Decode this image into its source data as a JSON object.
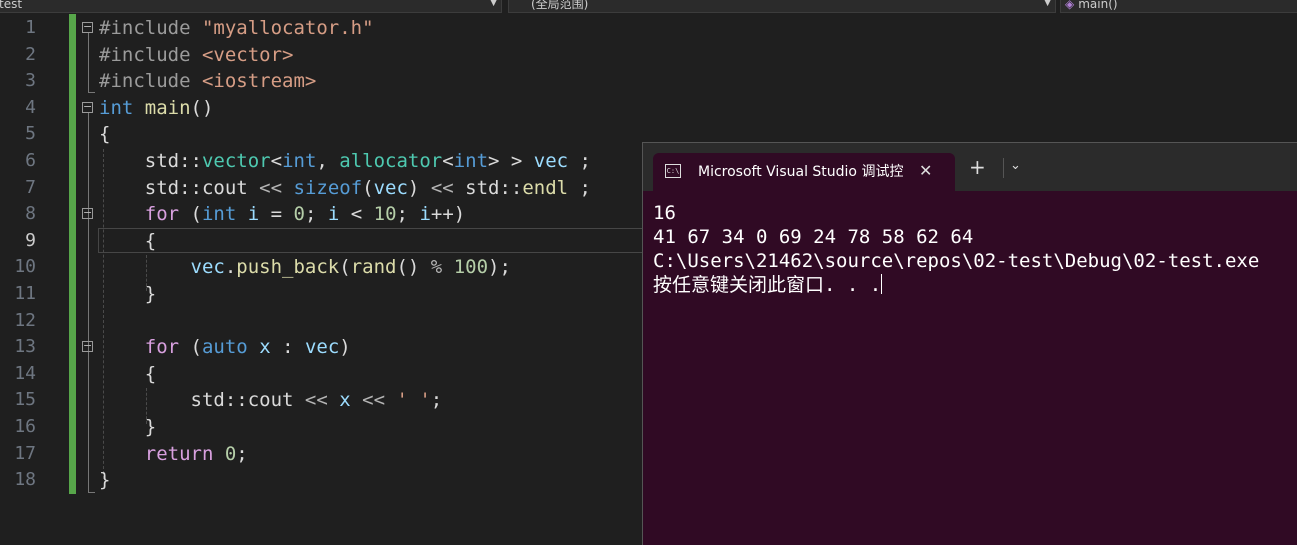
{
  "navbar": {
    "project": "test",
    "scope": "(全局范围)",
    "member": "main()"
  },
  "editor": {
    "line_numbers": [
      "1",
      "2",
      "3",
      "4",
      "5",
      "6",
      "7",
      "8",
      "9",
      "10",
      "11",
      "12",
      "13",
      "14",
      "15",
      "16",
      "17",
      "18"
    ],
    "current_line": "9",
    "code": {
      "include1_kw": "#include",
      "include1_arg": "\"myallocator.h\"",
      "include2_kw": "#include",
      "include2_arg": "<vector>",
      "include3_kw": "#include",
      "include3_arg": "<iostream>",
      "main_type": "int",
      "main_name": "main",
      "main_parens": "()",
      "open_brace": "{",
      "vec_std": "std::",
      "vec_type": "vector",
      "vec_lt": "<",
      "vec_int": "int",
      "vec_comma": ", ",
      "vec_alloc": "allocator",
      "vec_lt2": "<",
      "vec_int2": "int",
      "vec_gt": "> > ",
      "vec_name": "vec",
      "vec_semi": " ;",
      "cout_std": "std::",
      "cout_name": "cout",
      "cout_op": " << ",
      "sizeof_kw": "sizeof",
      "sizeof_open": "(",
      "sizeof_arg": "vec",
      "sizeof_close": ")",
      "cout_op2": " << ",
      "endl_std": "std::",
      "endl_name": "endl",
      "cout_semi": " ;",
      "for1_kw": "for",
      "for1_open": " (",
      "for1_int": "int",
      "for1_i": " i",
      "for1_eq": " = ",
      "for1_zero": "0",
      "for1_semi": "; ",
      "for1_i2": "i",
      "for1_lt": " < ",
      "for1_ten": "10",
      "for1_semi2": "; ",
      "for1_i3": "i",
      "for1_inc": "++)",
      "for1_lbrace": "{",
      "push_vec": "vec",
      "push_dot": ".",
      "push_name": "push_back",
      "push_open": "(",
      "push_rand": "rand",
      "push_rand_parens": "()",
      "push_mod": " % ",
      "push_100": "100",
      "push_close": ");",
      "for1_rbrace": "}",
      "for2_kw": "for",
      "for2_open": " (",
      "for2_auto": "auto",
      "for2_x": " x",
      "for2_colon": " : ",
      "for2_vec": "vec",
      "for2_close": ")",
      "for2_lbrace": "{",
      "print_std": "std::",
      "print_cout": "cout",
      "print_op": " << ",
      "print_x": "x",
      "print_op2": " << ",
      "print_char": "' '",
      "print_semi": ";",
      "for2_rbrace": "}",
      "return_kw": "return",
      "return_zero": " 0",
      "return_semi": ";",
      "close_brace": "}"
    }
  },
  "terminal": {
    "tab_title": "Microsoft Visual Studio 调试控制台",
    "tab_icon": "C:\\",
    "close_glyph": "✕",
    "new_tab_glyph": "+",
    "dropdown_glyph": "⌄",
    "output": [
      "16",
      "41 67 34 0 69 24 78 58 62 64",
      "C:\\Users\\21462\\source\\repos\\02-test\\Debug\\02-test.exe",
      "按任意键关闭此窗口. . ."
    ]
  },
  "colors": {
    "editor_bg": "#1f1f1f",
    "terminal_bg": "#300a24",
    "change_bar": "#57a64a"
  }
}
